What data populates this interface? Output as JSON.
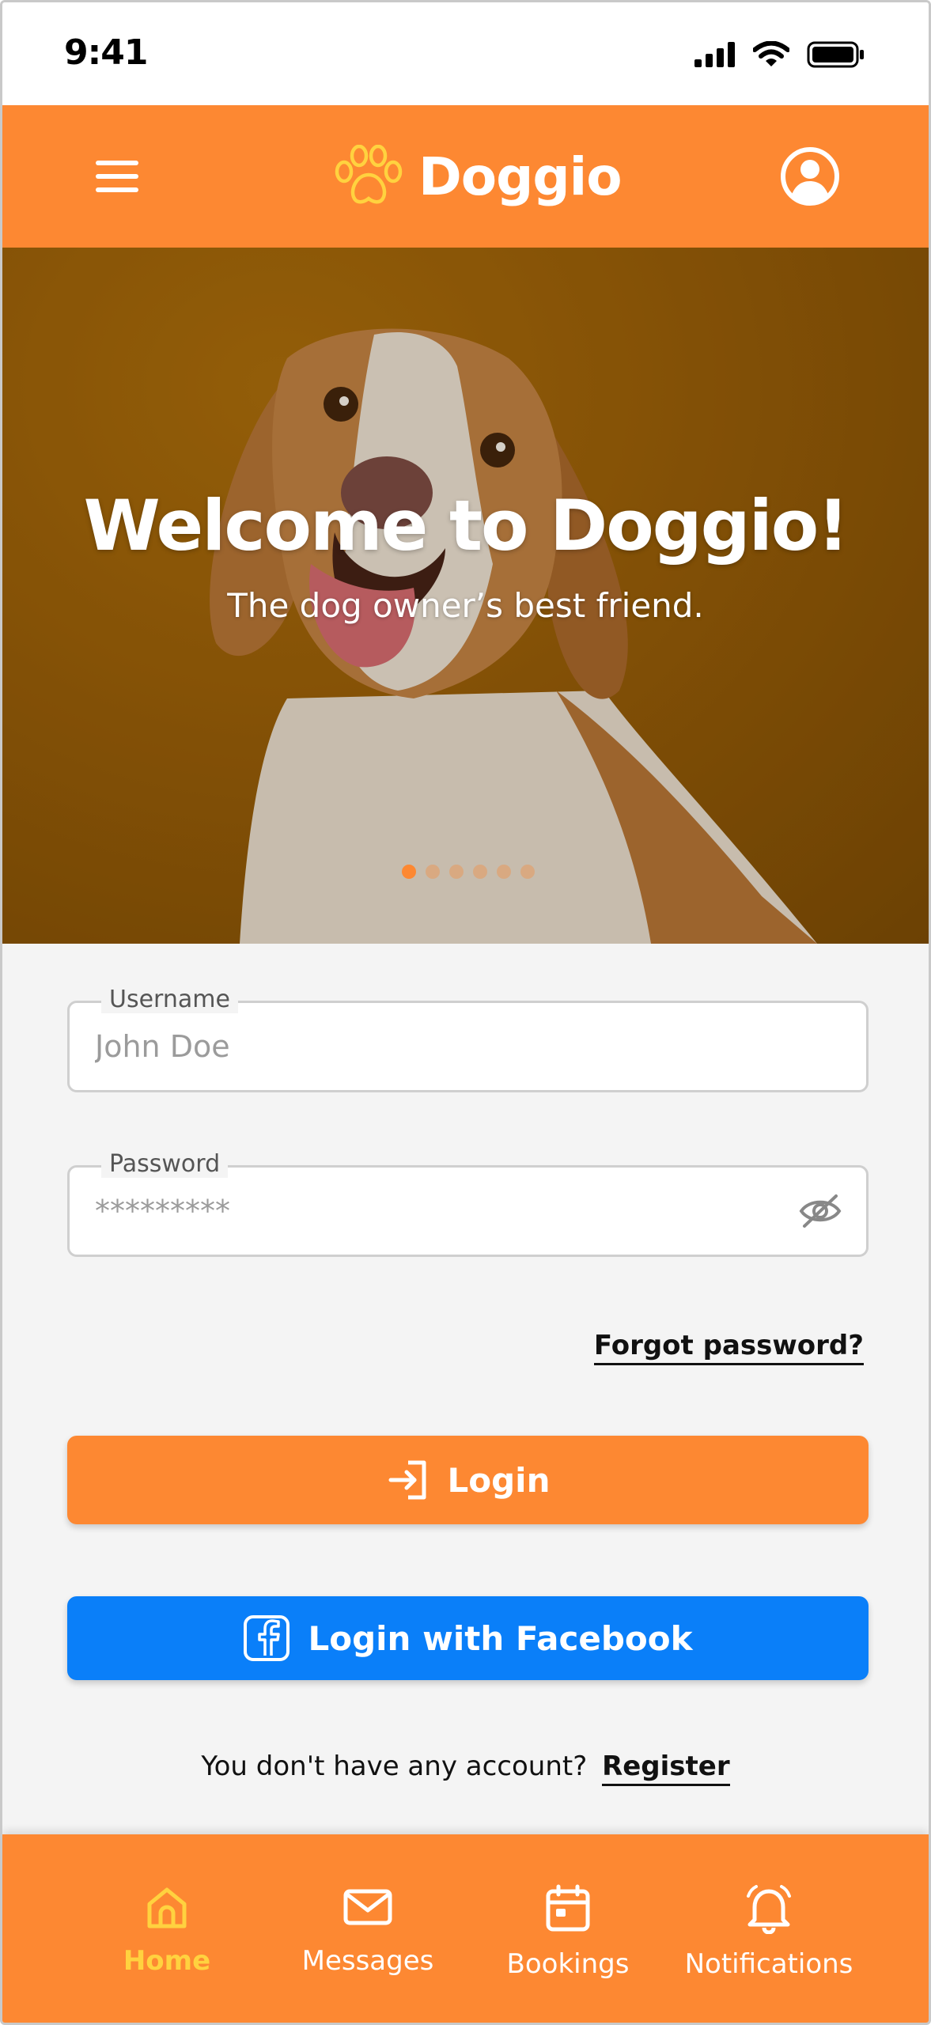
{
  "status_bar": {
    "time": "9:41"
  },
  "header": {
    "brand_name": "Doggio"
  },
  "hero": {
    "title": "Welcome to Doggio!",
    "subtitle": "The dog owner’s best friend.",
    "slide_count": 6,
    "active_slide": 1
  },
  "form": {
    "username": {
      "label": "Username",
      "placeholder": "John Doe"
    },
    "password": {
      "label": "Password",
      "value": "*********"
    },
    "forgot_label": "Forgot password?"
  },
  "buttons": {
    "login_label": "Login",
    "facebook_label": "Login with Facebook"
  },
  "register": {
    "prompt": "You don't have any account?",
    "link_label": "Register"
  },
  "bottom_nav": {
    "items": [
      {
        "label": "Home",
        "icon": "home-icon",
        "active": true
      },
      {
        "label": "Messages",
        "icon": "mail-icon",
        "active": false
      },
      {
        "label": "Bookings",
        "icon": "calendar-icon",
        "active": false
      },
      {
        "label": "Notifications",
        "icon": "bell-icon",
        "active": false
      }
    ]
  },
  "colors": {
    "primary": "#fd8832",
    "facebook": "#0a7ff9",
    "accent_yellow": "#ffd23f",
    "background": "#f4f4f4"
  }
}
